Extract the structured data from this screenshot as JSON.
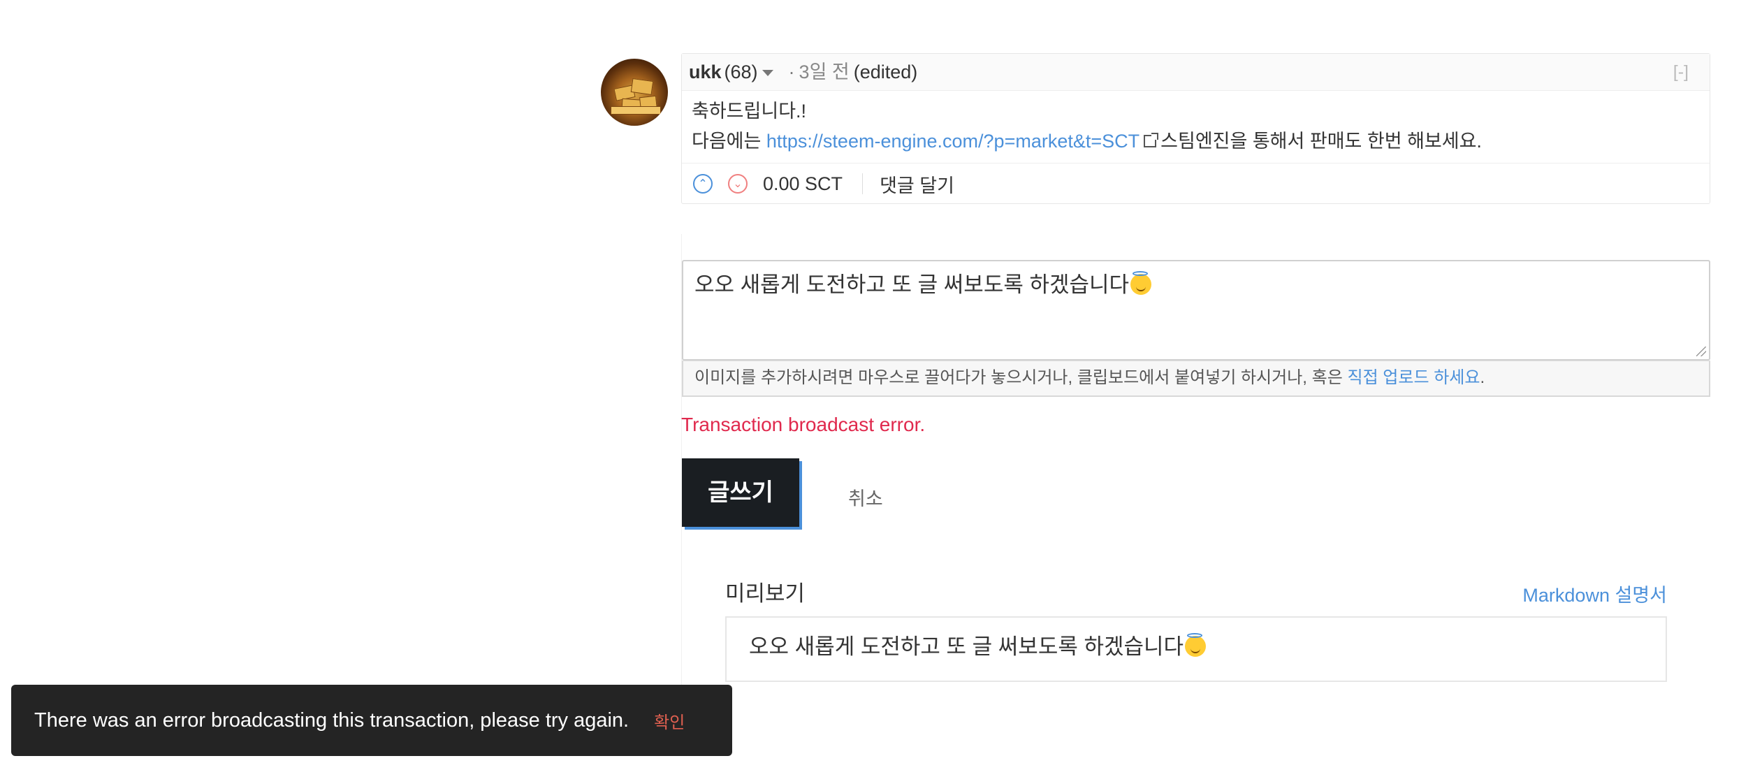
{
  "comment": {
    "author": "ukk",
    "reputation": "(68)",
    "dot": "·",
    "time": "3일 전",
    "edited": "(edited)",
    "collapse": "[-]",
    "body_line1": "축하드립니다.!",
    "body_line2_prefix": "다음에는",
    "link_text": "https://steem-engine.com/?p=market&t=SCT",
    "body_line2_suffix": "스팀엔진을 통해서 판매도 한번 해보세요.",
    "payout": "0.00 SCT",
    "reply": "댓글 달기"
  },
  "editor": {
    "text": "오오 새롭게 도전하고 또 글 써보도록 하겠습니다",
    "drop_hint": "이미지를 추가하시려면 마우스로 끌어다가 놓으시거나, 클립보드에서 붙여넣기 하시거나, 혹은",
    "upload_link": "직접 업로드 하세요",
    "period": ".",
    "error": "Transaction broadcast error.",
    "submit": "글쓰기",
    "cancel": "취소"
  },
  "preview": {
    "title": "미리보기",
    "markdown_link": "Markdown 설명서",
    "text": "오오 새롭게 도전하고 또 글 써보도록 하겠습니다"
  },
  "toast": {
    "message": "There was an error broadcasting this transaction, please try again.",
    "action": "확인"
  },
  "colors": {
    "link": "#4b90da",
    "error": "#e0294d",
    "button_bg": "#1a1e22",
    "toast_bg": "#242424",
    "toast_action": "#e06050"
  },
  "icons": {
    "upvote": "chevron-up-circle-icon",
    "downvote": "chevron-down-circle-icon",
    "external": "external-link-icon",
    "emoji": "smiling-face-with-halo-icon"
  }
}
